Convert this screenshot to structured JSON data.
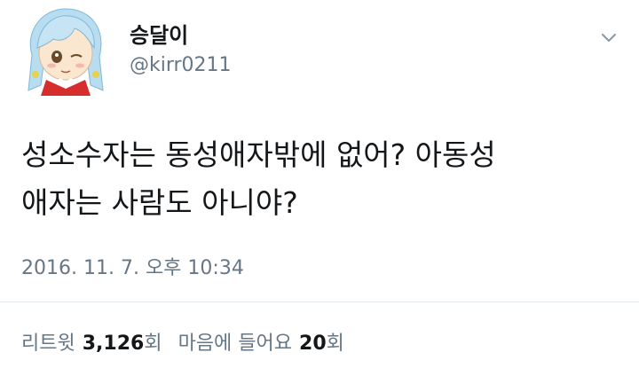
{
  "user": {
    "display_name": "승달이",
    "username": "@kirr0211"
  },
  "tweet": {
    "text": "성소수자는 동성애자밖에 없어? 아동성\n애자는 사람도 아니야?",
    "timestamp": "2016. 11. 7. 오후 10:34"
  },
  "stats": {
    "retweets_label": "리트윗",
    "retweets_count": "3,126",
    "retweets_unit": "회",
    "likes_label": "마음에 들어요",
    "likes_count": "20",
    "likes_unit": "회"
  },
  "icons": {
    "menu": "chevron-down-icon"
  },
  "colors": {
    "text": "#14171a",
    "secondary": "#657786",
    "divider": "#e1e8ed"
  }
}
